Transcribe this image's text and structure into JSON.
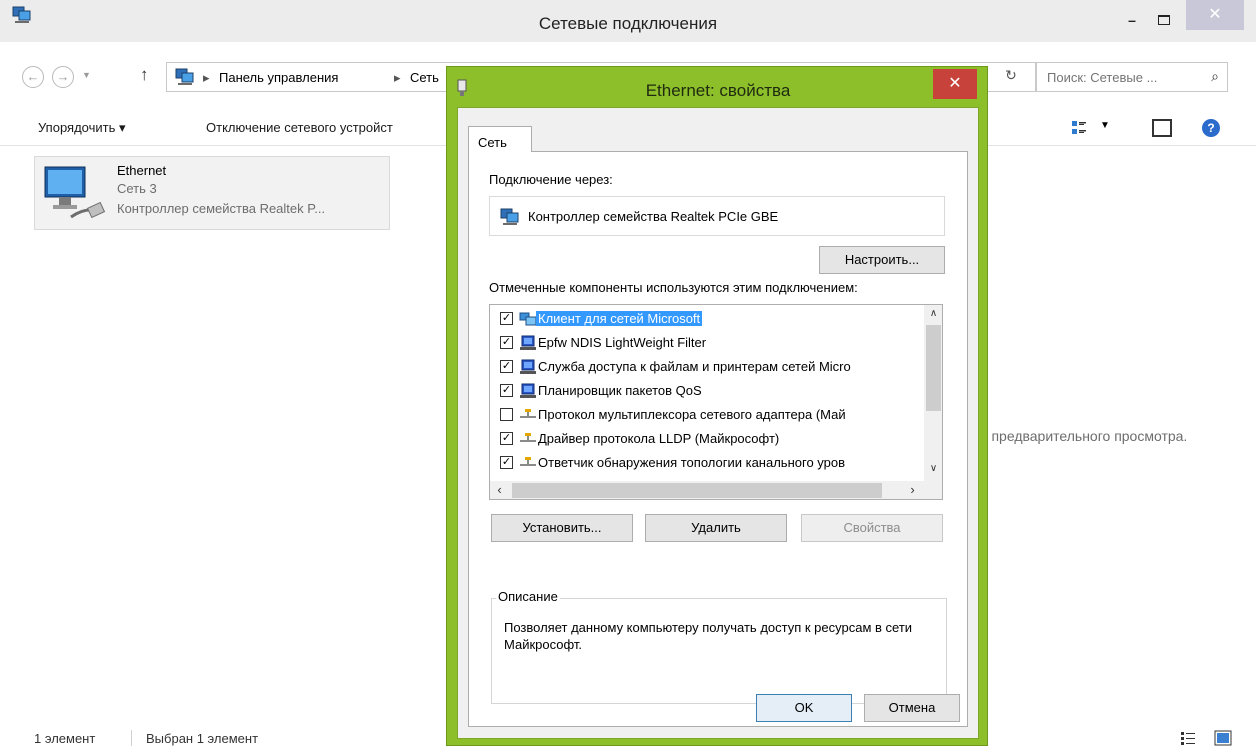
{
  "explorer": {
    "title": "Сетевые подключения",
    "window_controls": {
      "minimize": "–",
      "close": "✕"
    },
    "address": {
      "crumbs": [
        "Панель управления",
        "Сеть"
      ],
      "separator": "▸"
    },
    "search": {
      "placeholder": "Поиск: Сетевые ..."
    },
    "toolbar": {
      "organize": "Упорядочить ▾",
      "disable": "Отключение сетевого устройст"
    },
    "item": {
      "name": "Ethernet",
      "network": "Сеть 3",
      "adapter": "Контроллер семейства Realtek P..."
    },
    "preview_hint": "я предварительного просмотра.",
    "status": {
      "count": "1 элемент",
      "selected": "Выбран 1 элемент"
    }
  },
  "dialog": {
    "title": "Ethernet: свойства",
    "close": "✕",
    "tab": "Сеть",
    "connect_using_label": "Подключение через:",
    "adapter_name": "Контроллер семейства Realtek PCIe GBE",
    "configure_button": "Настроить...",
    "components_label": "Отмеченные компоненты используются этим подключением:",
    "components": [
      {
        "label": "Клиент для сетей Microsoft",
        "checked": true,
        "icon": "network-client-icon",
        "selected": true
      },
      {
        "label": "Epfw NDIS LightWeight Filter",
        "checked": true,
        "icon": "network-service-icon"
      },
      {
        "label": "Служба доступа к файлам и принтерам сетей Micro",
        "checked": true,
        "icon": "network-service-icon"
      },
      {
        "label": "Планировщик пакетов QoS",
        "checked": true,
        "icon": "network-service-icon"
      },
      {
        "label": "Протокол мультиплексора сетевого адаптера (Май",
        "checked": false,
        "icon": "protocol-icon"
      },
      {
        "label": "Драйвер протокола LLDP (Майкрософт)",
        "checked": true,
        "icon": "protocol-icon"
      },
      {
        "label": "Ответчик обнаружения топологии канального уров",
        "checked": true,
        "icon": "protocol-icon"
      }
    ],
    "install_button": "Установить...",
    "uninstall_button": "Удалить",
    "properties_button": "Свойства",
    "description_legend": "Описание",
    "description_text": "Позволяет данному компьютеру получать доступ к ресурсам в сети Майкрософт.",
    "ok_button": "OK",
    "cancel_button": "Отмена"
  },
  "colors": {
    "dialog_frame": "#8cbf2a",
    "close_red": "#c7423a",
    "selection": "#3399ff"
  }
}
